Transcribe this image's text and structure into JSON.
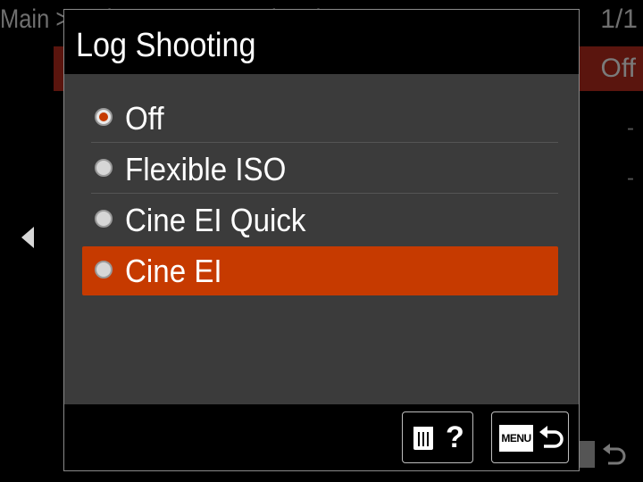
{
  "background": {
    "breadcrumb": "Main > Mult Camera   Log Shooting Set",
    "page_indicator": "1/1",
    "row1_value": "Off",
    "row2_value": "-",
    "row3_value": "-",
    "menu_return_label": "U"
  },
  "dialog": {
    "title": "Log Shooting",
    "options": [
      {
        "label": "Off",
        "checked": true,
        "selected": false
      },
      {
        "label": "Flexible ISO",
        "checked": false,
        "selected": false
      },
      {
        "label": "Cine EI Quick",
        "checked": false,
        "selected": false
      },
      {
        "label": "Cine EI",
        "checked": false,
        "selected": true
      }
    ],
    "footer": {
      "delete_help_label": "?",
      "menu_label": "MENU"
    }
  },
  "colors": {
    "accent": "#c63a00",
    "panel": "#3b3b3b",
    "background": "#000000"
  },
  "icons": [
    "left-arrow-icon",
    "radio-icon",
    "trash-icon",
    "help-icon",
    "menu-icon",
    "return-arrow-icon"
  ]
}
